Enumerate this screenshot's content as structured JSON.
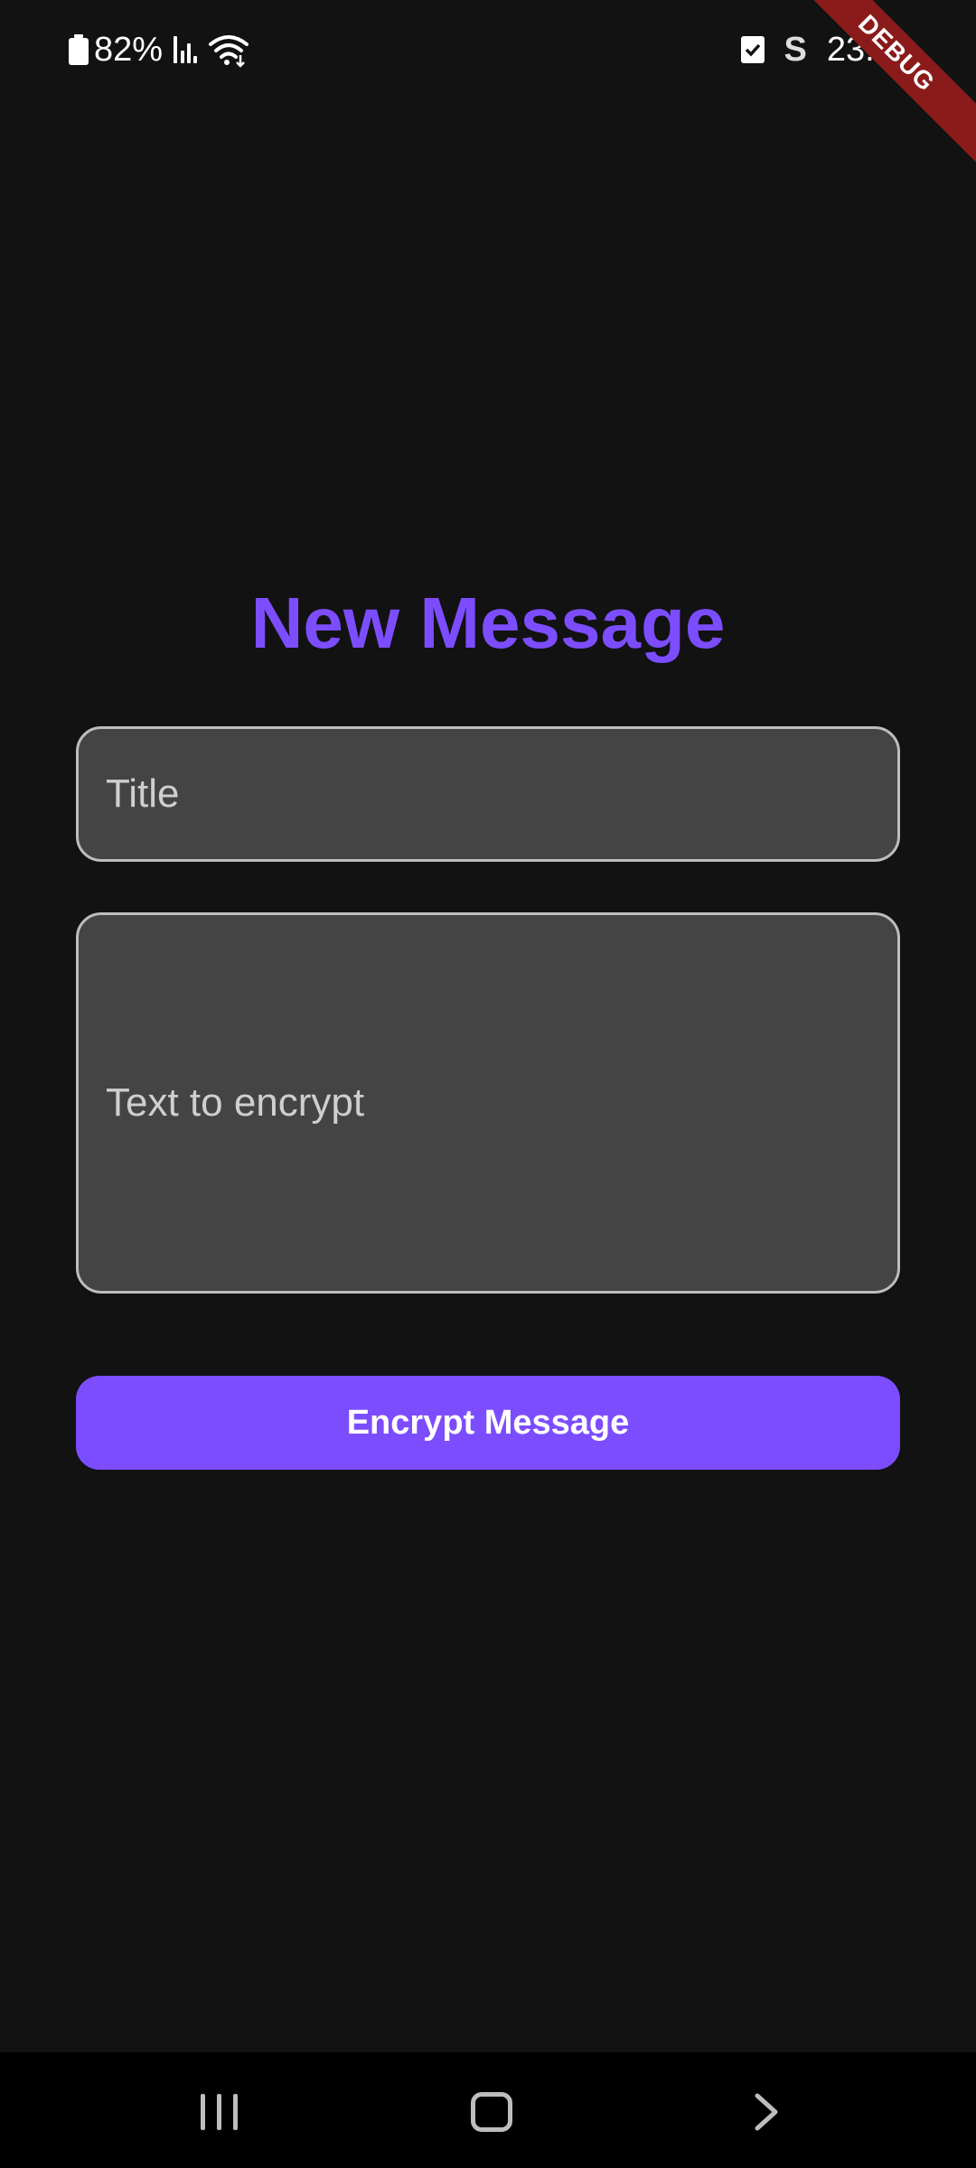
{
  "status_bar": {
    "battery": "82%",
    "time": "23:39",
    "icons": [
      "battery-icon",
      "signal-icon",
      "wifi-icon",
      "check-icon",
      "s-icon"
    ]
  },
  "debug_banner": "DEBUG",
  "screen": {
    "title": "New Message",
    "title_field": {
      "placeholder": "Title",
      "value": ""
    },
    "message_field": {
      "placeholder": "Text to encrypt",
      "value": ""
    },
    "submit_label": "Encrypt Message"
  },
  "nav_bar": {
    "icons": [
      "recents-icon",
      "home-icon",
      "back-icon"
    ]
  },
  "colors": {
    "background": "#121212",
    "accent": "#7c4dff",
    "field_bg": "#444444",
    "field_border": "#bdbdbd"
  }
}
